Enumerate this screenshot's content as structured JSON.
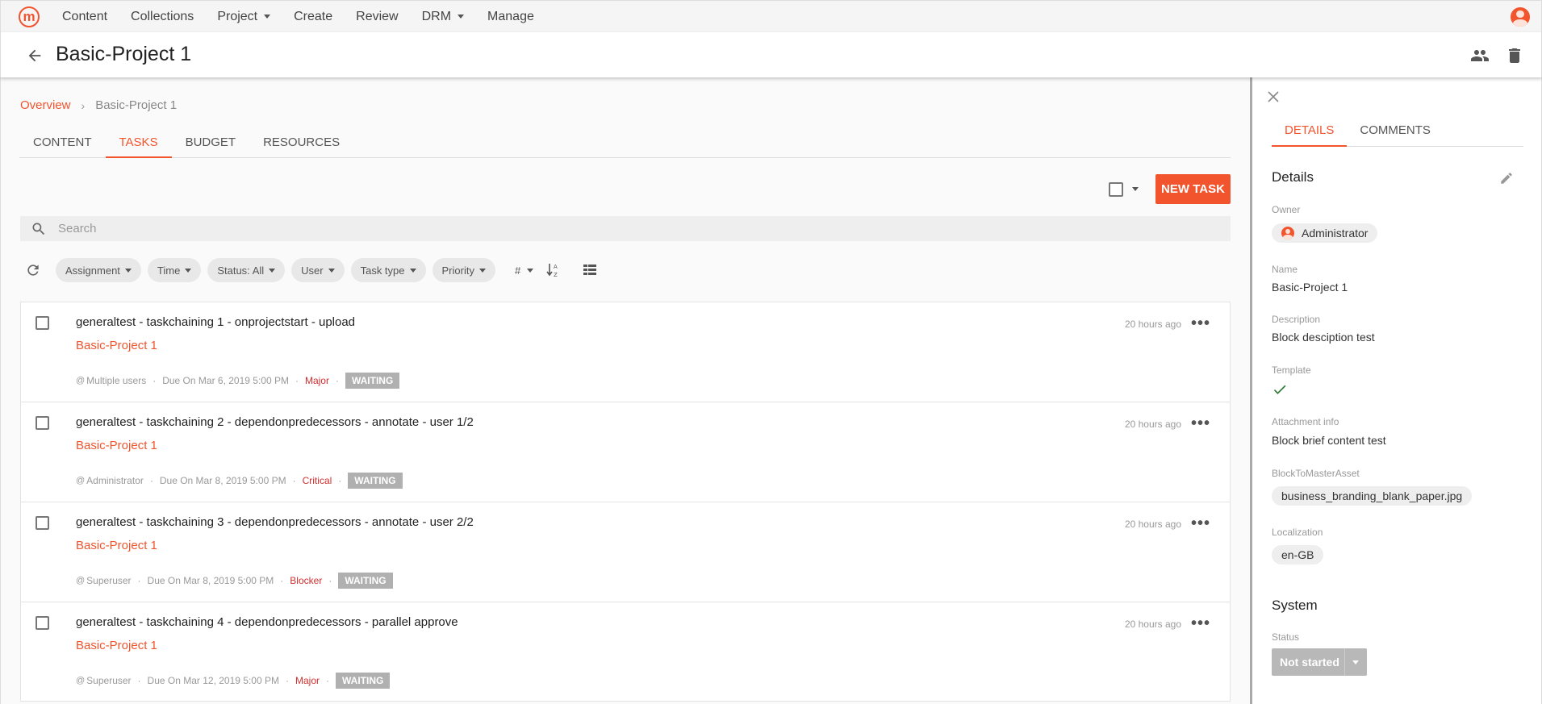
{
  "topnav": {
    "logo_letter": "m",
    "items": [
      {
        "label": "Content",
        "has_menu": false
      },
      {
        "label": "Collections",
        "has_menu": false
      },
      {
        "label": "Project",
        "has_menu": true
      },
      {
        "label": "Create",
        "has_menu": false
      },
      {
        "label": "Review",
        "has_menu": false
      },
      {
        "label": "DRM",
        "has_menu": true
      },
      {
        "label": "Manage",
        "has_menu": false
      }
    ]
  },
  "header": {
    "title": "Basic-Project 1",
    "icons": [
      "back-arrow-icon",
      "people-icon",
      "trash-icon"
    ]
  },
  "breadcrumb": {
    "root": "Overview",
    "current": "Basic-Project 1"
  },
  "tabs": [
    {
      "label": "CONTENT",
      "active": false
    },
    {
      "label": "TASKS",
      "active": true
    },
    {
      "label": "BUDGET",
      "active": false
    },
    {
      "label": "RESOURCES",
      "active": false
    }
  ],
  "toolbar": {
    "new_task": "NEW TASK"
  },
  "search": {
    "placeholder": "Search",
    "value": ""
  },
  "filters": {
    "chips": [
      "Assignment",
      "Time",
      "Status: All",
      "User",
      "Task type",
      "Priority"
    ],
    "hash_label": "#"
  },
  "tasks": [
    {
      "title": "generaltest - taskchaining 1 - onprojectstart - upload",
      "project": "Basic-Project 1",
      "assignee": "Multiple users",
      "due": "Due On Mar 6, 2019 5:00 PM",
      "priority": "Major",
      "status": "WAITING",
      "time": "20 hours ago"
    },
    {
      "title": "generaltest - taskchaining 2 - dependonpredecessors - annotate - user 1/2",
      "project": "Basic-Project 1",
      "assignee": "Administrator",
      "due": "Due On Mar 8, 2019 5:00 PM",
      "priority": "Critical",
      "status": "WAITING",
      "time": "20 hours ago"
    },
    {
      "title": "generaltest - taskchaining 3 - dependonpredecessors - annotate - user 2/2",
      "project": "Basic-Project 1",
      "assignee": "Superuser",
      "due": "Due On Mar 8, 2019 5:00 PM",
      "priority": "Blocker",
      "status": "WAITING",
      "time": "20 hours ago"
    },
    {
      "title": "generaltest - taskchaining 4 - dependonpredecessors - parallel approve",
      "project": "Basic-Project 1",
      "assignee": "Superuser",
      "due": "Due On Mar 12, 2019 5:00 PM",
      "priority": "Major",
      "status": "WAITING",
      "time": "20 hours ago"
    }
  ],
  "panel": {
    "tabs": [
      {
        "label": "DETAILS",
        "active": true
      },
      {
        "label": "COMMENTS",
        "active": false
      }
    ],
    "details_heading": "Details",
    "owner": {
      "label": "Owner",
      "value": "Administrator"
    },
    "name": {
      "label": "Name",
      "value": "Basic-Project 1"
    },
    "description": {
      "label": "Description",
      "value": "Block desciption test"
    },
    "template": {
      "label": "Template",
      "checked": true
    },
    "attachment": {
      "label": "Attachment info",
      "value": "Block brief content test"
    },
    "master_asset": {
      "label": "BlockToMasterAsset",
      "value": "business_branding_blank_paper.jpg"
    },
    "localization": {
      "label": "Localization",
      "value": "en-GB"
    },
    "system_heading": "System",
    "status": {
      "label": "Status",
      "value": "Not started"
    }
  },
  "colors": {
    "accent": "#f2542d",
    "priority": "#d32f2f",
    "badge": "#b0b0b0",
    "check": "#2e7d32"
  }
}
